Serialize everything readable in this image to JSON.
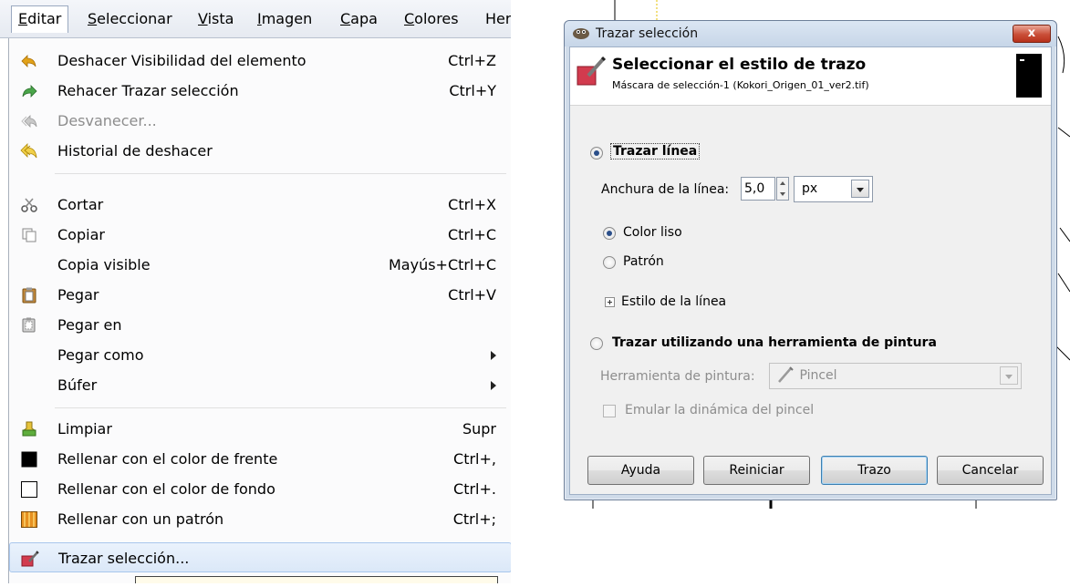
{
  "menubar": {
    "items": [
      {
        "label": "Editar",
        "active": true
      },
      {
        "label": "Seleccionar"
      },
      {
        "label": "Vista"
      },
      {
        "label": "Imagen"
      },
      {
        "label": "Capa"
      },
      {
        "label": "Colores"
      },
      {
        "label": "Herra"
      }
    ]
  },
  "edit_menu": {
    "items": [
      {
        "label": "Deshacer Visibilidad del elemento",
        "shortcut": "Ctrl+Z",
        "icon": "undo-icon"
      },
      {
        "label": "Rehacer Trazar selección",
        "shortcut": "Ctrl+Y",
        "icon": "redo-icon"
      },
      {
        "label": "Desvanecer...",
        "shortcut": "",
        "icon": "fade-icon",
        "disabled": true
      },
      {
        "label": "Historial de deshacer",
        "shortcut": "",
        "icon": "undo-history-icon"
      },
      {
        "label": "Cortar",
        "shortcut": "Ctrl+X",
        "icon": "scissors-icon"
      },
      {
        "label": "Copiar",
        "shortcut": "Ctrl+C",
        "icon": "copy-icon"
      },
      {
        "label": "Copia visible",
        "shortcut": "Mayús+Ctrl+C",
        "icon": ""
      },
      {
        "label": "Pegar",
        "shortcut": "Ctrl+V",
        "icon": "paste-icon"
      },
      {
        "label": "Pegar en",
        "shortcut": "",
        "icon": "paste-into-icon"
      },
      {
        "label": "Pegar como",
        "shortcut": "",
        "icon": "",
        "submenu": true
      },
      {
        "label": "Búfer",
        "shortcut": "",
        "icon": "",
        "submenu": true
      },
      {
        "label": "Limpiar",
        "shortcut": "Supr",
        "icon": "clear-icon"
      },
      {
        "label": "Rellenar con el color de frente",
        "shortcut": "Ctrl+,",
        "icon": "fill-fg-icon"
      },
      {
        "label": "Rellenar con el color de fondo",
        "shortcut": "Ctrl+.",
        "icon": "fill-bg-icon"
      },
      {
        "label": "Rellenar con un patrón",
        "shortcut": "Ctrl+;",
        "icon": "fill-pattern-icon"
      },
      {
        "label": "Trazar selección...",
        "shortcut": "",
        "icon": "stroke-selection-icon",
        "highlighted": true
      }
    ]
  },
  "dialog": {
    "window_title": "Trazar selección",
    "close_label": "x",
    "header_title": "Seleccionar el estilo de trazo",
    "header_subtitle": "Máscara de selección-1 (Kokori_Origen_01_ver2.tif)",
    "stroke_line_label": "Trazar línea",
    "line_width_label": "Anchura de la línea:",
    "line_width_value": "5,0",
    "unit_value": "px",
    "solid_color_label": "Color liso",
    "pattern_label": "Patrón",
    "line_style_label": "Estilo de la línea",
    "paint_tool_stroke_label": "Trazar utilizando una herramienta de pintura",
    "paint_tool_label": "Herramienta de pintura:",
    "paint_tool_value": "Pincel",
    "emulate_label": "Emular la dinámica del pincel",
    "buttons": {
      "help": "Ayuda",
      "reset": "Reiniciar",
      "stroke": "Trazo",
      "cancel": "Cancelar"
    }
  },
  "colors": {
    "menu_highlight": "#dbe8f8",
    "dialog_frame": "#cfdbe9",
    "close_button": "#c94e37"
  }
}
